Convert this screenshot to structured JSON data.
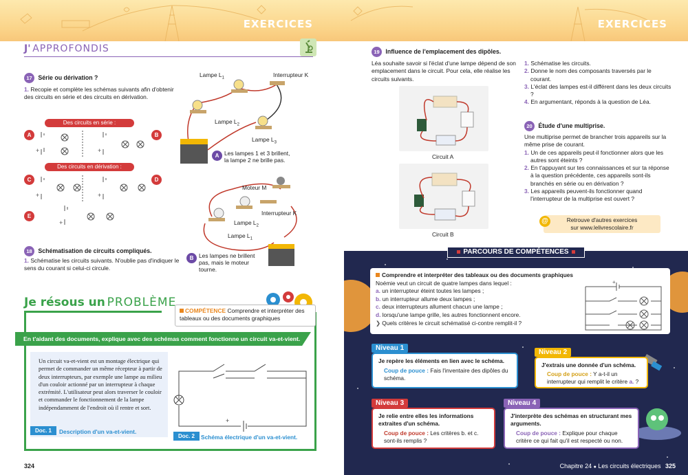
{
  "left": {
    "header": "EXERCICES",
    "section_j": "J'",
    "section_title": "APPROFONDIS",
    "ex17": {
      "num": "17",
      "title": "Série ou dérivation ?",
      "item1_num": "1.",
      "item1": "Recopie et complète les schémas suivants afin d'obtenir des circuits en série et des circuits en dérivation.",
      "band_serie": "Des circuits en série :",
      "band_deriv": "Des circuits en dérivation :",
      "labels": [
        "A",
        "B",
        "C",
        "D",
        "E"
      ]
    },
    "ex18": {
      "num": "18",
      "title": "Schématisation de circuits compliqués.",
      "item1_num": "1.",
      "item1": "Schématise les circuits suivants. N'oublie pas d'indiquer le sens du courant si celui-ci circule."
    },
    "circA": {
      "lampe1": "Lampe L",
      "lampe1_sub": "1",
      "interrupteur": "Interrupteur K",
      "lampe2": "Lampe L",
      "lampe2_sub": "2",
      "lampe3": "Lampe L",
      "lampe3_sub": "3",
      "badge": "A",
      "caption": "Les lampes 1 et 3 brillent, la lampe 2 ne brille pas."
    },
    "circB": {
      "moteur": "Moteur M",
      "interrupteur": "Interrupteur K",
      "lampe2": "Lampe L",
      "lampe2_sub": "2",
      "lampe1": "Lampe L",
      "lampe1_sub": "1",
      "badge": "B",
      "caption": "Les lampes ne brillent pas, mais le moteur tourne."
    },
    "probleme": {
      "title_a": "Je résous un",
      "title_b": "PROBLÈME",
      "comp_label": "COMPÉTENCE",
      "comp_text": "Comprendre et interpréter des tableaux ou des documents graphiques",
      "task": "En t'aidant des documents, explique avec des schémas comment fonctionne un circuit va-et-vient.",
      "doc1_text": "Un circuit va-et-vient est un montage électrique qui permet de commander un même récepteur à partir de deux interrupteurs, par exemple une lampe au milieu d'un couloir actionné par un interrupteur à chaque extrémité. L'utilisateur peut alors traverser le couloir et commander le fonctionnement de la lampe indépendamment de l'endroit où il rentre et sort.",
      "doc1_tag": "Doc. 1",
      "doc1_caption": "Description d'un va-et-vient.",
      "doc2_tag": "Doc. 2",
      "doc2_caption": "Schéma électrique d'un va-et-vient."
    },
    "page_number": "324"
  },
  "right": {
    "header": "EXERCICES",
    "ex19": {
      "num": "19",
      "title": "Influence de l'emplacement des dipôles.",
      "intro": "Léa souhaite savoir si l'éclat d'une lampe dépend de son emplacement dans le circuit. Pour cela, elle réalise les circuits suivants.",
      "circuitA": "Circuit A",
      "circuitB": "Circuit B",
      "items": [
        {
          "n": "1.",
          "t": "Schématise les circuits."
        },
        {
          "n": "2.",
          "t": "Donne le nom des composants traversés par le courant."
        },
        {
          "n": "3.",
          "t": "L'éclat des lampes est-il différent dans les deux circuits ?"
        },
        {
          "n": "4.",
          "t": "En argumentant, réponds à la question de Léa."
        }
      ]
    },
    "ex20": {
      "num": "20",
      "title": "Étude d'une multiprise.",
      "intro": "Une multiprise permet de brancher trois appareils sur la même prise de courant.",
      "items": [
        {
          "n": "1.",
          "t": "Un de ces appareils peut-il fonctionner alors que les autres sont éteints ?"
        },
        {
          "n": "2.",
          "t": "En t'appuyant sur tes connaissances et sur ta réponse à la question précédente, ces appareils sont-ils branchés en série ou en dérivation ?"
        },
        {
          "n": "3.",
          "t": "Les appareils peuvent-ils fonctionner quand l'interrupteur de la multiprise est ouvert ?"
        }
      ]
    },
    "retrouve": {
      "line1": "Retrouve d'autres exercices",
      "line2": "sur www.lelivrescolaire.fr"
    },
    "parcours": {
      "title": "PARCOURS DE COMPÉTENCES",
      "comp": "Comprendre et interpréter des tableaux ou des documents graphiques",
      "intro": "Noémie veut un circuit de quatre lampes dans lequel :",
      "criteria": [
        {
          "k": "a.",
          "t": "un interrupteur éteint toutes les lampes ;"
        },
        {
          "k": "b.",
          "t": "un interrupteur allume deux lampes ;"
        },
        {
          "k": "c.",
          "t": "deux interrupteurs allument chacun une lampe ;"
        },
        {
          "k": "d.",
          "t": "lorsqu'une lampe grille, les autres fonctionnent encore."
        }
      ],
      "question": "Quels critères le circuit schématisé ci-contre remplit-il ?",
      "n1": {
        "head": "Niveau 1",
        "title": "Je repère les éléments en lien avec le schéma.",
        "cp": "Coup de pouce :",
        "text": "Fais l'inventaire des dipôles du schéma."
      },
      "n2": {
        "head": "Niveau 2",
        "title": "J'extrais une donnée d'un schéma.",
        "cp": "Coup de pouce :",
        "text": "Y a-t-il un interrupteur qui remplit le critère",
        "crit": "a.",
        "end": "?"
      },
      "n3": {
        "head": "Niveau 3",
        "title": "Je relie entre elles les informations extraites d'un schéma.",
        "cp": "Coup de pouce :",
        "text": "Les critères b. et c. sont-ils remplis ?"
      },
      "n4": {
        "head": "Niveau 4",
        "title": "J'interprète des schémas en structurant mes arguments.",
        "cp": "Coup de pouce :",
        "text": "Explique pour chaque critère ce qui fait qu'il est respecté ou non."
      }
    },
    "footer": {
      "chapter": "Chapitre 24",
      "sep": "●",
      "title": "Les circuits électriques",
      "page": "325"
    }
  },
  "colors": {
    "accent_purple": "#8a63b6",
    "red": "#d33b3b",
    "green": "#3aa24a",
    "navy": "#21284f",
    "blue": "#2b8fd0",
    "orange": "#e9871f",
    "yellow": "#f2b705"
  }
}
